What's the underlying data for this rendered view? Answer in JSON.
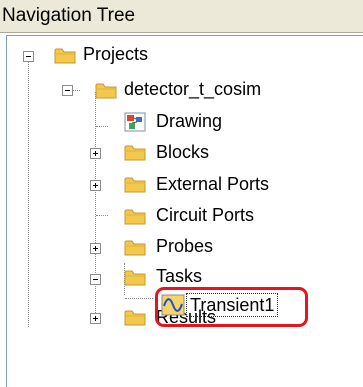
{
  "panel": {
    "title": "Navigation Tree"
  },
  "tree": {
    "root": {
      "label": "Projects",
      "expanded": true
    },
    "project": {
      "label": "detector_t_cosim",
      "expanded": true
    },
    "items": [
      {
        "label": "Drawing",
        "icon": "drawing-icon",
        "expandable": false
      },
      {
        "label": "Blocks",
        "icon": "folder-icon",
        "expandable": true,
        "expanded": false
      },
      {
        "label": "External Ports",
        "icon": "folder-icon",
        "expandable": true,
        "expanded": false
      },
      {
        "label": "Circuit Ports",
        "icon": "folder-icon",
        "expandable": false
      },
      {
        "label": "Probes",
        "icon": "folder-icon",
        "expandable": true,
        "expanded": false
      },
      {
        "label": "Tasks",
        "icon": "folder-icon",
        "expandable": true,
        "expanded": true
      },
      {
        "label": "Results",
        "icon": "folder-icon",
        "expandable": true,
        "expanded": false
      }
    ],
    "task_child": {
      "label": "Transient1",
      "icon": "waveform-icon",
      "selected": true
    }
  },
  "colors": {
    "highlight": "#e8131f",
    "folder": "#f2c94c",
    "folder_dark": "#c8962a",
    "title_bg": "#ece9d8"
  }
}
